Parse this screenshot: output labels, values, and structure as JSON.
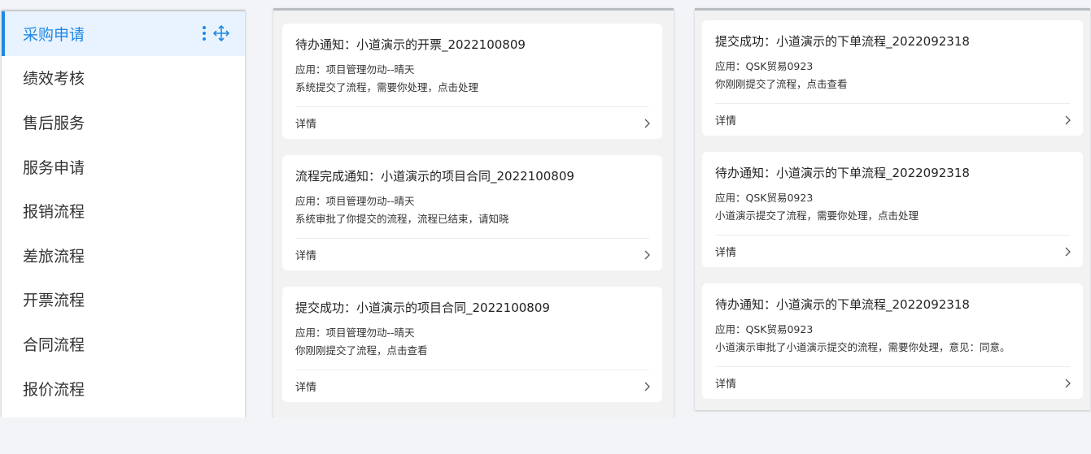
{
  "sidebar": {
    "items": [
      {
        "label": "采购申请",
        "active": true
      },
      {
        "label": "绩效考核"
      },
      {
        "label": "售后服务"
      },
      {
        "label": "服务申请"
      },
      {
        "label": "报销流程"
      },
      {
        "label": "差旅流程"
      },
      {
        "label": "开票流程"
      },
      {
        "label": "合同流程"
      },
      {
        "label": "报价流程"
      }
    ],
    "tools": [
      "more-vertical-icon",
      "move-icon"
    ]
  },
  "columns": [
    {
      "cards": [
        {
          "title": "待办通知：小道演示的开票_2022100809",
          "app": "应用：项目管理勿动--晴天",
          "message": "系统提交了流程，需要你处理，点击处理",
          "detail": "详情"
        },
        {
          "title": "流程完成通知：小道演示的项目合同_2022100809",
          "app": "应用：项目管理勿动--晴天",
          "message": "系统审批了你提交的流程，流程已结束，请知晓",
          "detail": "详情"
        },
        {
          "title": "提交成功：小道演示的项目合同_2022100809",
          "app": "应用：项目管理勿动--晴天",
          "message": "你刚刚提交了流程，点击查看",
          "detail": "详情"
        }
      ]
    },
    {
      "cards": [
        {
          "title": "提交成功：小道演示的下单流程_2022092318",
          "app": "应用：QSK贸易0923",
          "message": "你刚刚提交了流程，点击查看",
          "detail": "详情"
        },
        {
          "title": "待办通知：小道演示的下单流程_2022092318",
          "app": "应用：QSK贸易0923",
          "message": "小道演示提交了流程，需要你处理，点击处理",
          "detail": "详情"
        },
        {
          "title": "待办通知：小道演示的下单流程_2022092318",
          "app": "应用：QSK贸易0923",
          "message": "小道演示审批了小道演示提交的流程，需要你处理，意见：同意。",
          "detail": "详情"
        }
      ]
    }
  ],
  "colors": {
    "accent": "#1e88e5",
    "active_bg": "#e8f3ff"
  }
}
